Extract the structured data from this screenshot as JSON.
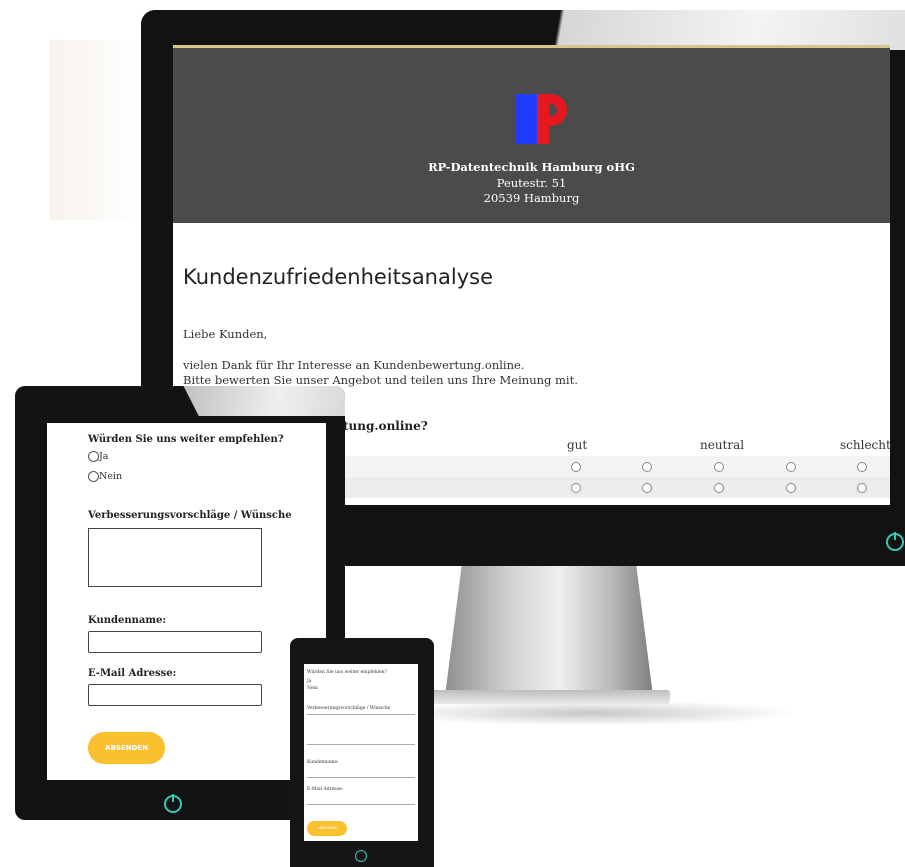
{
  "company": {
    "name": "RP-Datentechnik Hamburg oHG",
    "street": "Peutestr. 51",
    "city": "20539 Hamburg",
    "logo_colors": {
      "left": "#1f3cff",
      "right": "#e6171f"
    }
  },
  "desktop": {
    "title": "Kundenzufriedenheitsanalyse",
    "greeting": "Liebe Kunden,",
    "intro_line1": "vielen Dank für Ihr Interesse an Kundenbewertung.online.",
    "intro_line2": "Bitte bewerten Sie unser Angebot und teilen uns Ihre Meinung mit.",
    "question_partial": "tung.online?",
    "scale": {
      "good": "gut",
      "neutral": "neutral",
      "bad": "schlecht"
    }
  },
  "form": {
    "recommend_question": "Würden Sie uns weiter empfehlen?",
    "option_yes": "Ja",
    "option_no": "Nein",
    "suggestions_label": "Verbesserungsvorschläge / Wünsche",
    "customer_name_label": "Kundenname:",
    "email_label": "E-Mail Adresse:",
    "submit_label": "ABSENDEN"
  },
  "accent": {
    "submit": "#fbc02d",
    "power": "#36c9b3",
    "header_bg": "#4b4b4b"
  }
}
